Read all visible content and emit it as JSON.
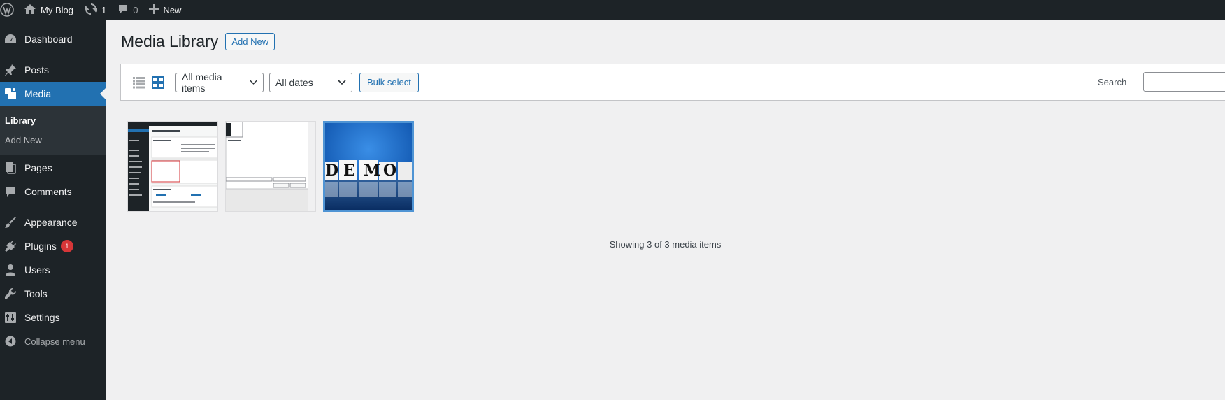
{
  "adminbar": {
    "site_name": "My Blog",
    "updates_count": "1",
    "comments_count": "0",
    "new_label": "New"
  },
  "sidebar": {
    "items": [
      {
        "label": "Dashboard",
        "icon": "dashboard-icon"
      },
      {
        "label": "Posts",
        "icon": "pin-icon"
      },
      {
        "label": "Media",
        "icon": "media-icon"
      },
      {
        "label": "Pages",
        "icon": "pages-icon"
      },
      {
        "label": "Comments",
        "icon": "comments-icon"
      },
      {
        "label": "Appearance",
        "icon": "brush-icon"
      },
      {
        "label": "Plugins",
        "icon": "plugin-icon",
        "badge": "1"
      },
      {
        "label": "Users",
        "icon": "users-icon"
      },
      {
        "label": "Tools",
        "icon": "wrench-icon"
      },
      {
        "label": "Settings",
        "icon": "settings-icon"
      }
    ],
    "submenu": [
      "Library",
      "Add New"
    ],
    "collapse_label": "Collapse menu"
  },
  "main": {
    "title": "Media Library",
    "add_new_label": "Add New",
    "filter_type": "All media items",
    "filter_date": "All dates",
    "bulk_select_label": "Bulk select",
    "search_label": "Search",
    "search_value": "",
    "showing_text": "Showing 3 of 3 media items",
    "thumb3_letters": "DEMO"
  },
  "colors": {
    "accent": "#2271b1",
    "adminbar": "#1d2327",
    "badge": "#d63638"
  }
}
